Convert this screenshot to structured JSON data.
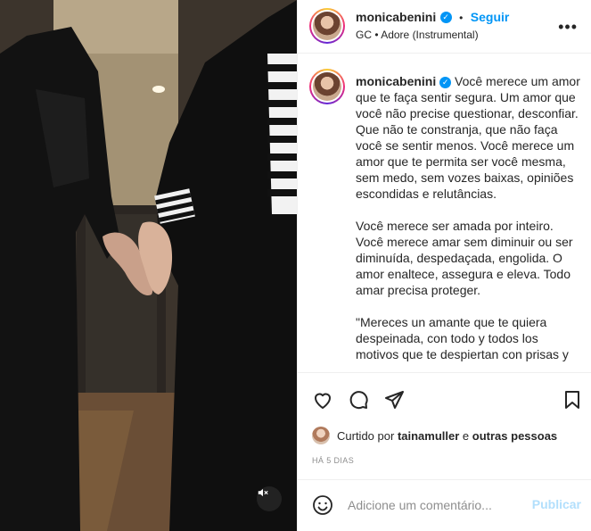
{
  "header": {
    "username": "monicabenini",
    "separator": "•",
    "follow_label": "Seguir",
    "song": "GC • Adore (Instrumental)",
    "more_label": "•••"
  },
  "caption": {
    "username": "monicabenini",
    "text": "Você merece um amor que te faça sentir segura. Um amor que você não precise questionar, desconfiar. Que não te constranja, que não faça você se sentir menos. Você merece um amor que te permita ser você mesma, sem medo, sem vozes baixas, opiniões escondidas e relutâncias.\n\nVocê merece ser amada por inteiro. Você merece amar sem diminuir ou ser diminuída, despedaçada, engolida. O amor enaltece, assegura e eleva. Todo amar precisa proteger.\n\n\"Mereces un amante que te quiera despeinada, con todo y todos los motivos que te despiertan con prisas y"
  },
  "likes": {
    "prefix": "Curtido por",
    "user": "tainamuller",
    "middle": "e",
    "others": "outras pessoas"
  },
  "timestamp": "HÁ 5 DIAS",
  "comment": {
    "placeholder": "Adicione um comentário...",
    "publish_label": "Publicar"
  },
  "icons": {
    "verified": "verified-badge",
    "like": "heart-icon",
    "comment": "comment-icon",
    "share": "paper-plane-icon",
    "save": "bookmark-icon",
    "emoji": "emoji-icon",
    "mute": "speaker-muted-icon"
  },
  "colors": {
    "accent": "#0095f6",
    "publish_disabled": "#b2dffc",
    "secondary_text": "#8e8e8e"
  }
}
